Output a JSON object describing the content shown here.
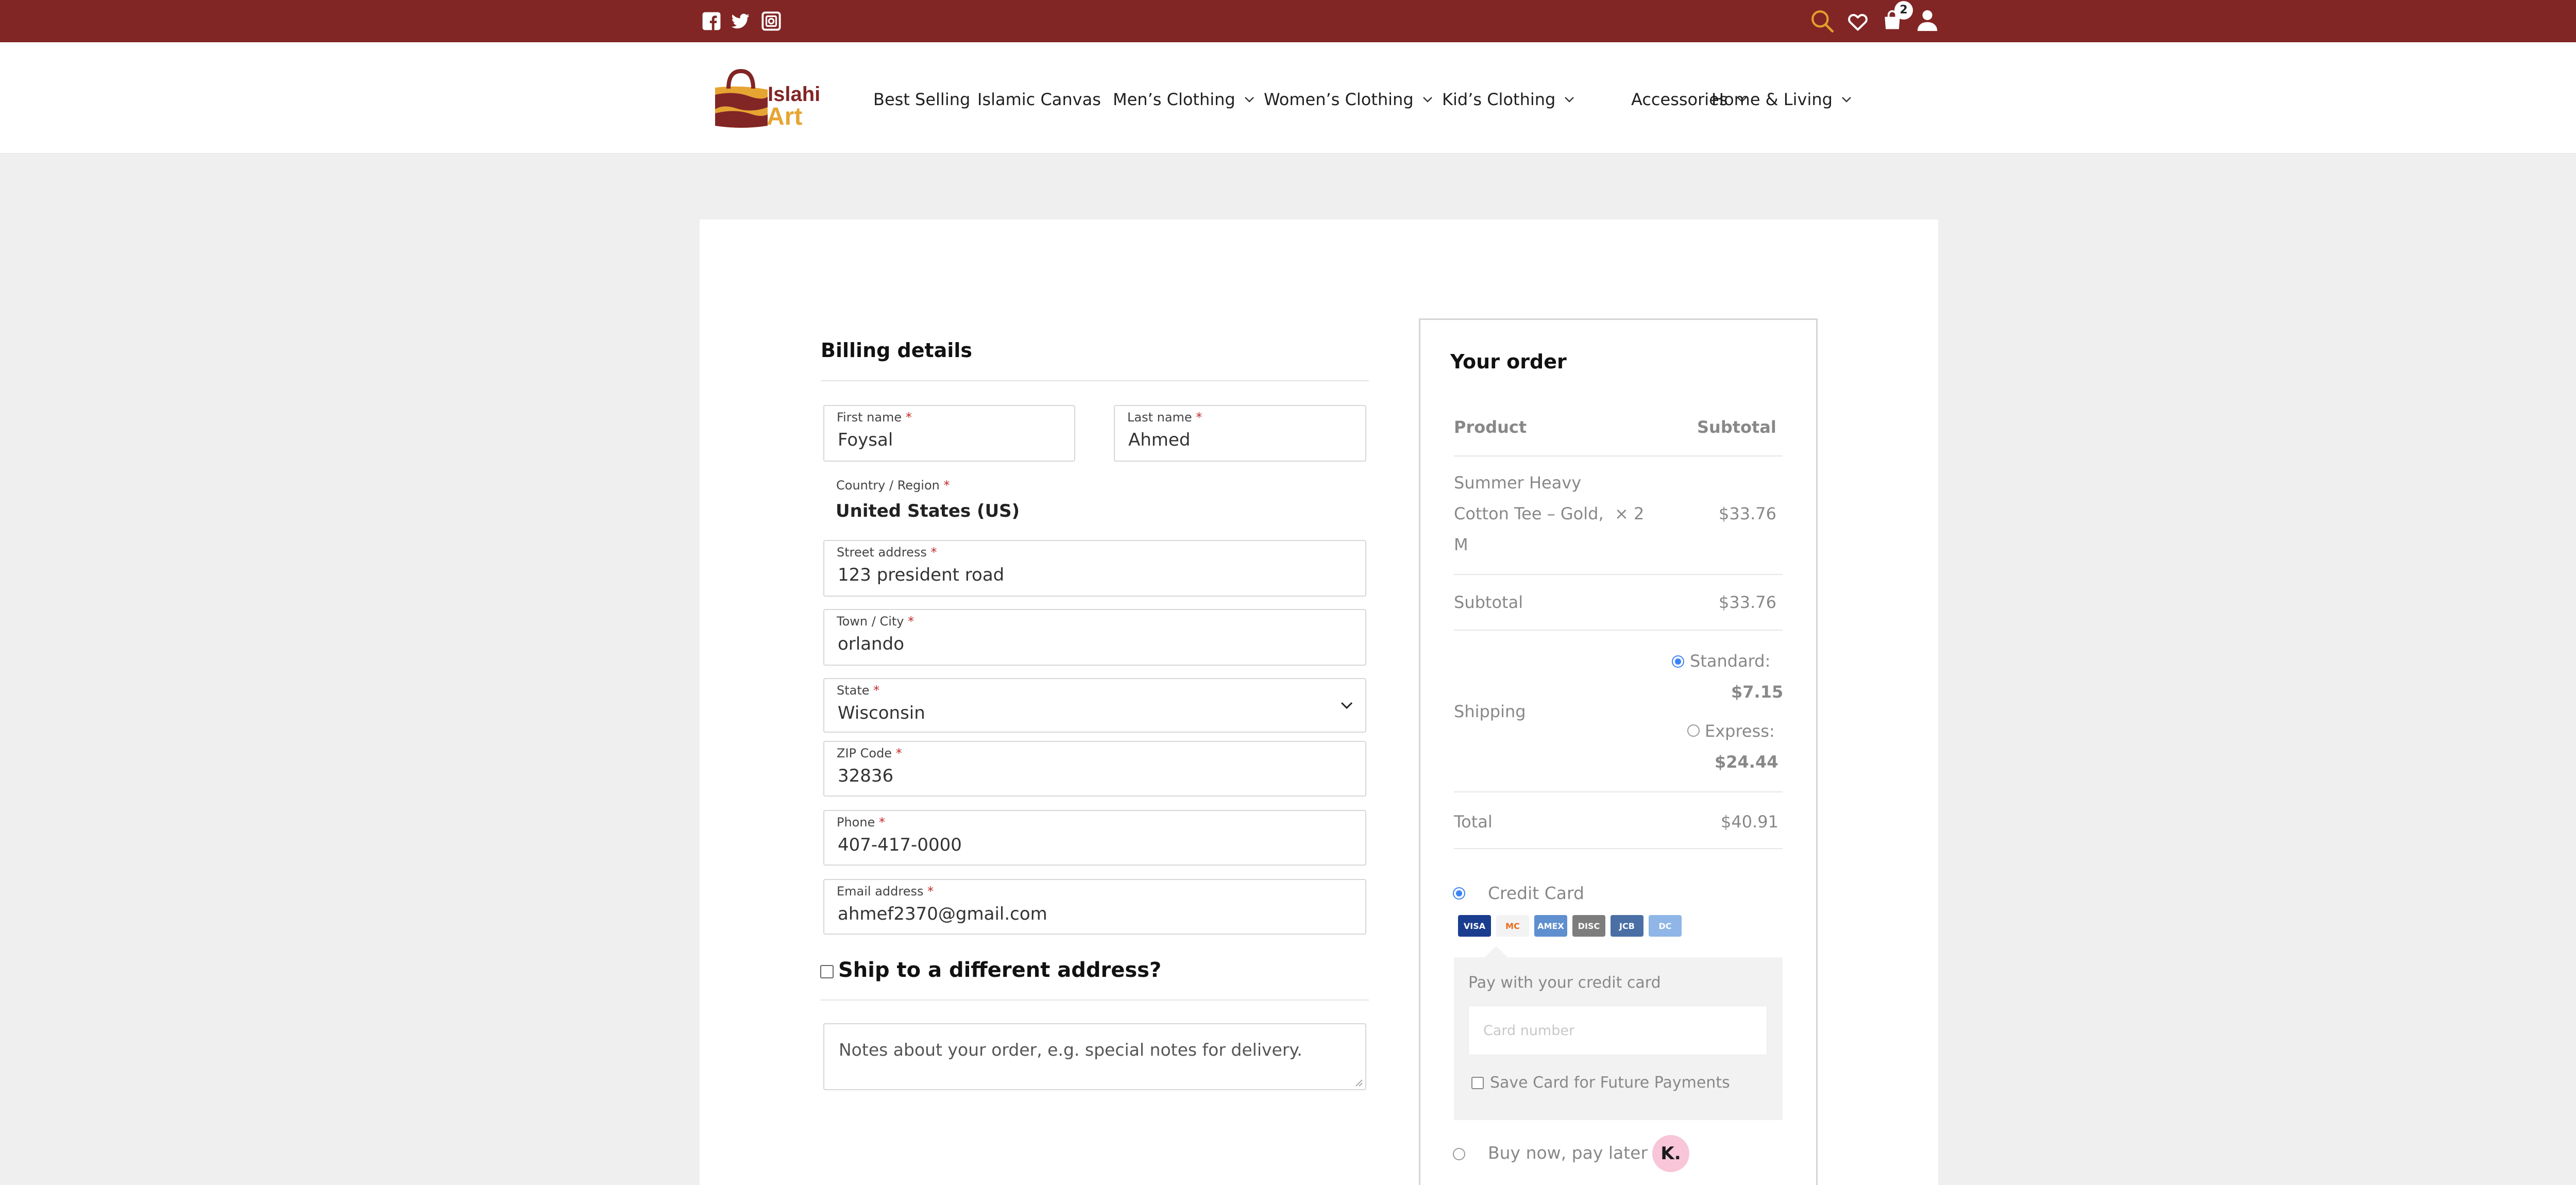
{
  "topbar": {
    "social": [
      "facebook-icon",
      "twitter-icon",
      "instagram-icon"
    ],
    "actions": [
      "search-icon",
      "heart-icon",
      "cart-icon",
      "user-icon"
    ],
    "cart_count": "2",
    "bg_color": "#822525"
  },
  "header": {
    "logo": {
      "line1": "Islahi",
      "line2": "Art"
    },
    "nav": [
      {
        "label": "Best Selling"
      },
      {
        "label": "Islamic Canvas"
      },
      {
        "label": "Men’s Clothing"
      },
      {
        "label": "Women’s Clothing"
      },
      {
        "label": "Kid’s Clothing"
      },
      {
        "label": "Accessories"
      },
      {
        "label": "Home & Living"
      }
    ]
  },
  "billing": {
    "title": "Billing details",
    "required_mark": "*",
    "first_name": {
      "label": "First name",
      "value": "Foysal"
    },
    "last_name": {
      "label": "Last name",
      "value": "Ahmed"
    },
    "country": {
      "label": "Country / Region",
      "value": "United States (US)"
    },
    "street": {
      "label": "Street address",
      "value": "123 president road"
    },
    "city": {
      "label": "Town / City",
      "value": "orlando"
    },
    "state": {
      "label": "State",
      "value": "Wisconsin"
    },
    "zip": {
      "label": "ZIP Code",
      "value": "32836"
    },
    "phone": {
      "label": "Phone",
      "value": "407-417-0000"
    },
    "email": {
      "label": "Email address",
      "value": "ahmef2370@gmail.com"
    },
    "ship_different": "Ship to a different address?",
    "notes_placeholder": "Notes about your order, e.g. special notes for delivery."
  },
  "order": {
    "title": "Your order",
    "col_product": "Product",
    "col_subtotal": "Subtotal",
    "item": {
      "name_lines": [
        "Summer Heavy",
        "Cotton Tee – Gold,",
        "M"
      ],
      "qty": "× 2",
      "price": "$33.76"
    },
    "subtotal_label": "Subtotal",
    "subtotal_value": "$33.76",
    "shipping_label": "Shipping",
    "standard_label": "Standard:",
    "standard_price": "$7.15",
    "express_label": "Express:",
    "express_price": "$24.44",
    "total_label": "Total",
    "total_value": "$40.91",
    "payment": {
      "credit_card_label": "Credit Card",
      "card_brands": [
        "VISA",
        "MC",
        "AMEX",
        "DISC",
        "JCB",
        "DC"
      ],
      "pay_with": "Pay with your credit card",
      "card_number_placeholder": "Card number",
      "save_card": "Save Card for Future Payments",
      "bnpl_label": "Buy now, pay later",
      "klarna_mark": "K."
    }
  }
}
